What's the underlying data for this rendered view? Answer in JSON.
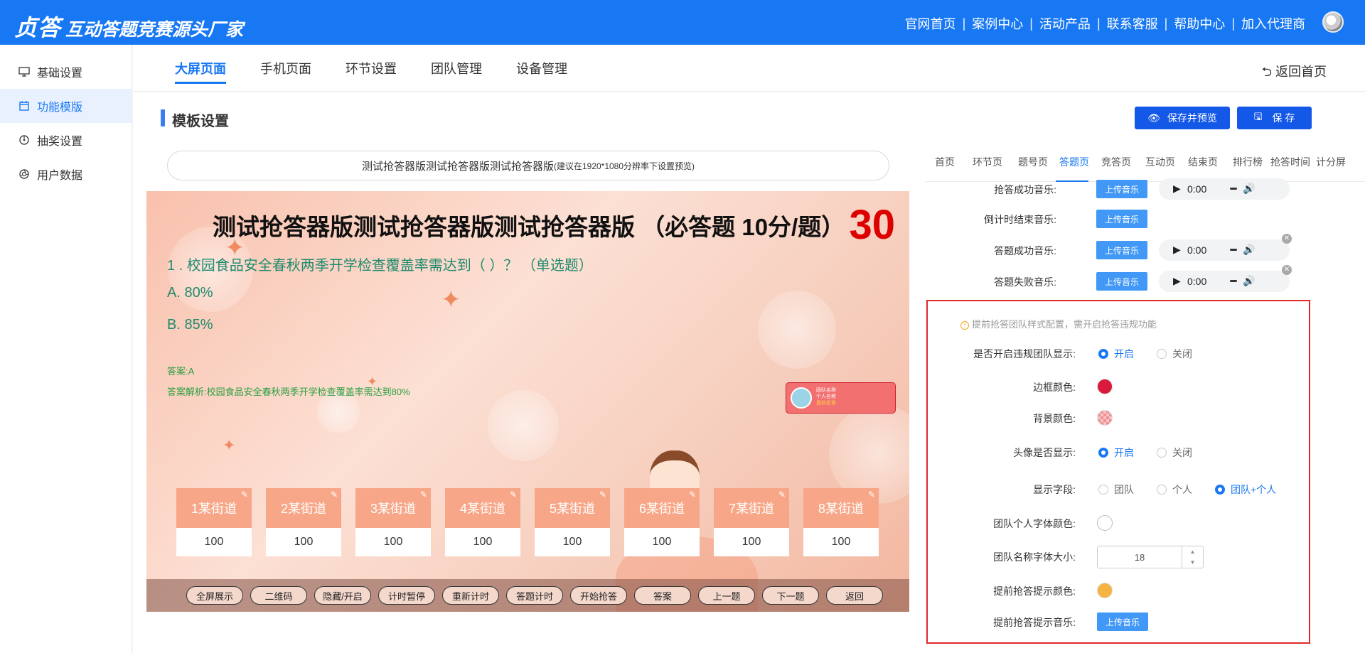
{
  "brand": {
    "logo": "贞答",
    "tagline": "互动答题竞赛源头厂家"
  },
  "topnav": [
    "官网首页",
    "案例中心",
    "活动产品",
    "联系客服",
    "帮助中心",
    "加入代理商"
  ],
  "sidebar": [
    {
      "label": "基础设置",
      "icon": "monitor-icon"
    },
    {
      "label": "功能模版",
      "icon": "calendar-icon",
      "active": true
    },
    {
      "label": "抽奖设置",
      "icon": "dial-icon"
    },
    {
      "label": "用户数据",
      "icon": "aperture-icon"
    }
  ],
  "tabs": [
    "大屏页面",
    "手机页面",
    "环节设置",
    "团队管理",
    "设备管理"
  ],
  "back_home": "返回首页",
  "section_title": "模板设置",
  "buttons": {
    "save_preview": "保存并预览",
    "save": "保 存"
  },
  "preview": {
    "name": "测试抢答器版测试抢答器版测试抢答器版",
    "hint": "(建议在1920*1080分辨率下设置预览)",
    "title": "测试抢答器版测试抢答器版测试抢答器版 （必答题 10分/题）",
    "timer": "30",
    "question": "1 . 校园食品安全春秋两季开学检查覆盖率需达到（ ）？ （单选题）",
    "options": [
      "A. 80%",
      "B. 85%"
    ],
    "answer": "答案:A",
    "analysis": "答案解析:校园食品安全春秋两季开学检查覆盖率需达到80%",
    "team_card": [
      "团队名称",
      "个人名称",
      "提前抢答"
    ],
    "teams": [
      {
        "name": "1某街道",
        "score": "100"
      },
      {
        "name": "2某街道",
        "score": "100"
      },
      {
        "name": "3某街道",
        "score": "100"
      },
      {
        "name": "4某街道",
        "score": "100"
      },
      {
        "name": "5某街道",
        "score": "100"
      },
      {
        "name": "6某街道",
        "score": "100"
      },
      {
        "name": "7某街道",
        "score": "100"
      },
      {
        "name": "8某街道",
        "score": "100"
      }
    ],
    "controls": [
      "全屏展示",
      "二维码",
      "隐藏/开启",
      "计时暂停",
      "重新计时",
      "答题计时",
      "开始抢答",
      "答案",
      "上一题",
      "下一题",
      "返回"
    ]
  },
  "panel": {
    "tabs": [
      "首页",
      "环节页",
      "题号页",
      "答题页",
      "竞答页",
      "互动页",
      "结束页",
      "排行榜",
      "抢答时间",
      "计分屏"
    ],
    "active_tab": 3,
    "upload_label": "上传音乐",
    "audio_time": "0:00",
    "music_rows": [
      {
        "label": "抢答成功音乐:",
        "has_audio": true
      },
      {
        "label": "倒计时结束音乐:",
        "has_audio": false
      },
      {
        "label": "答题成功音乐:",
        "has_audio": true
      },
      {
        "label": "答题失败音乐:",
        "has_audio": true
      }
    ],
    "notice": "提前抢答团队样式配置，需开启抢答违规功能",
    "violation_show": {
      "label": "是否开启违规团队显示:",
      "on": "开启",
      "off": "关闭"
    },
    "border_color": {
      "label": "边框颜色:",
      "color": "#d91a3c"
    },
    "bg_color": {
      "label": "背景颜色:",
      "color": "#f08f8f"
    },
    "avatar_show": {
      "label": "头像是否显示:",
      "on": "开启",
      "off": "关闭"
    },
    "fields": {
      "label": "显示字段:",
      "options": [
        "团队",
        "个人",
        "团队+个人"
      ],
      "selected": "团队+个人"
    },
    "font_color": {
      "label": "团队个人字体颜色:",
      "color": "#ffffff"
    },
    "font_size": {
      "label": "团队名称字体大小:",
      "value": "18"
    },
    "hint_color": {
      "label": "提前抢答提示颜色:",
      "color": "#f5b342"
    },
    "hint_music": {
      "label": "提前抢答提示音乐:"
    }
  },
  "colors": {
    "primary": "#1878f3",
    "dark_button": "#1458e8",
    "alert_border": "#e0282a"
  }
}
